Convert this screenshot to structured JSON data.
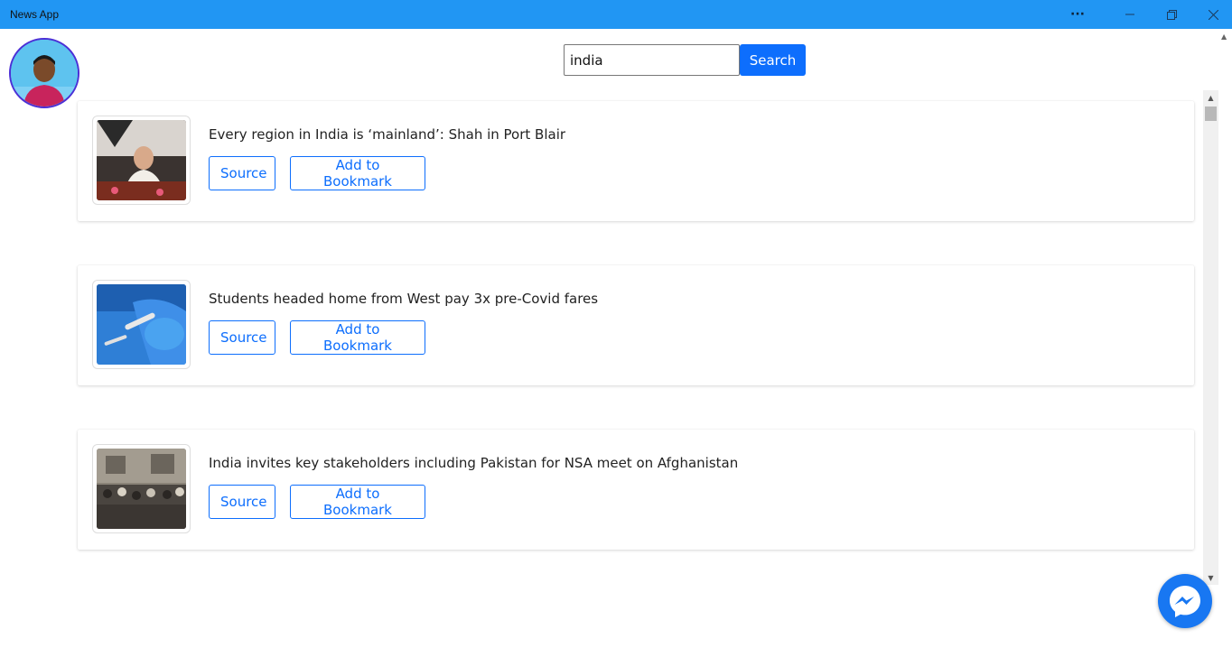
{
  "window": {
    "title": "News App",
    "controls": {
      "more": "···",
      "minimize": "—",
      "maximize": "❐",
      "close": "✕"
    }
  },
  "search": {
    "value": "india",
    "button_label": "Search"
  },
  "articles": [
    {
      "headline": "Every region in India is ‘mainland’: Shah in Port Blair",
      "source_label": "Source",
      "bookmark_label": "Add to Bookmark"
    },
    {
      "headline": "Students headed home from West pay 3x pre-Covid fares",
      "source_label": "Source",
      "bookmark_label": "Add to Bookmark"
    },
    {
      "headline": "India invites key stakeholders including Pakistan for NSA meet on Afghanistan",
      "source_label": "Source",
      "bookmark_label": "Add to Bookmark"
    }
  ],
  "colors": {
    "titlebar": "#2196f3",
    "primary": "#0d6efd",
    "messenger": "#1877f2"
  },
  "icons": {
    "avatar": "user-avatar",
    "fab": "messenger-icon"
  }
}
